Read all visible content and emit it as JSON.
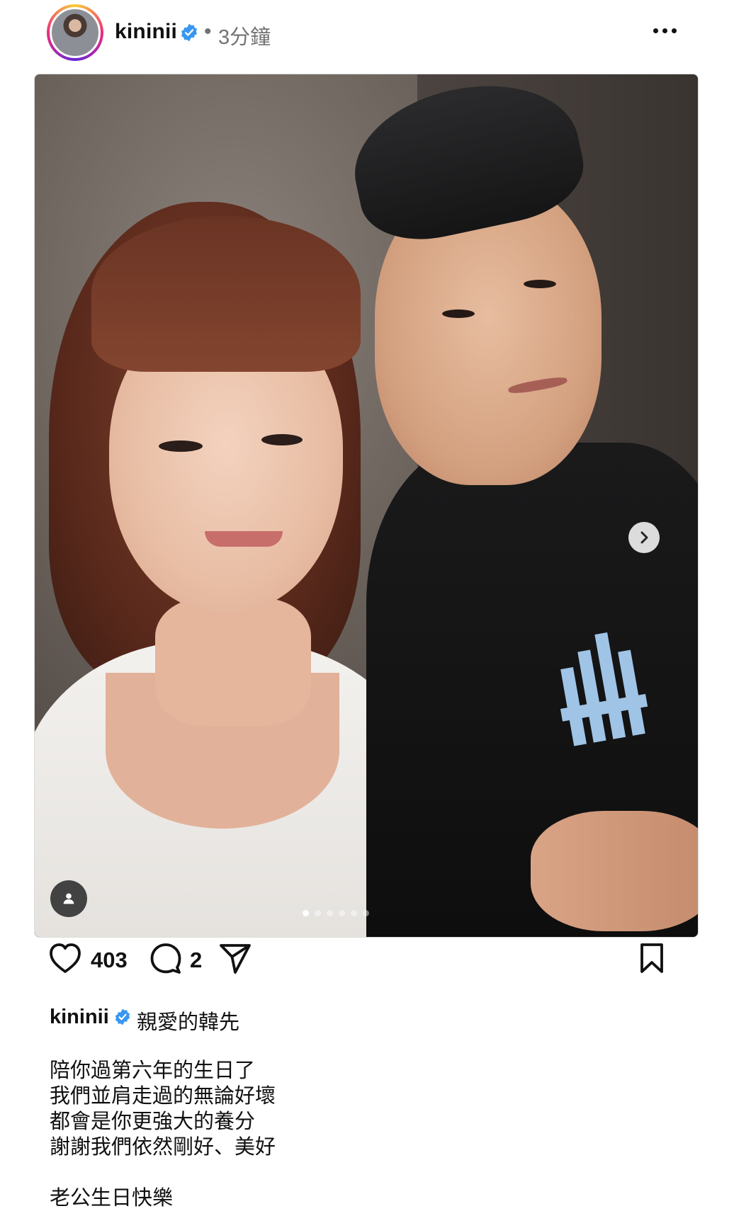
{
  "header": {
    "username": "kininii",
    "separator": "•",
    "time": "3分鐘"
  },
  "post": {
    "carousel": {
      "total": 6,
      "current": 1
    }
  },
  "actions": {
    "likes": "403",
    "comments": "2"
  },
  "caption": {
    "username": "kininii",
    "first_line": "親愛的韓先",
    "lines": [
      "陪你過第六年的生日了",
      "我們並肩走過的無論好壞",
      "都會是你更強大的養分",
      "謝謝我們依然剛好、美好",
      "",
      "老公生日快樂"
    ]
  },
  "colors": {
    "verified": "#3897f0",
    "muted": "#737373"
  }
}
